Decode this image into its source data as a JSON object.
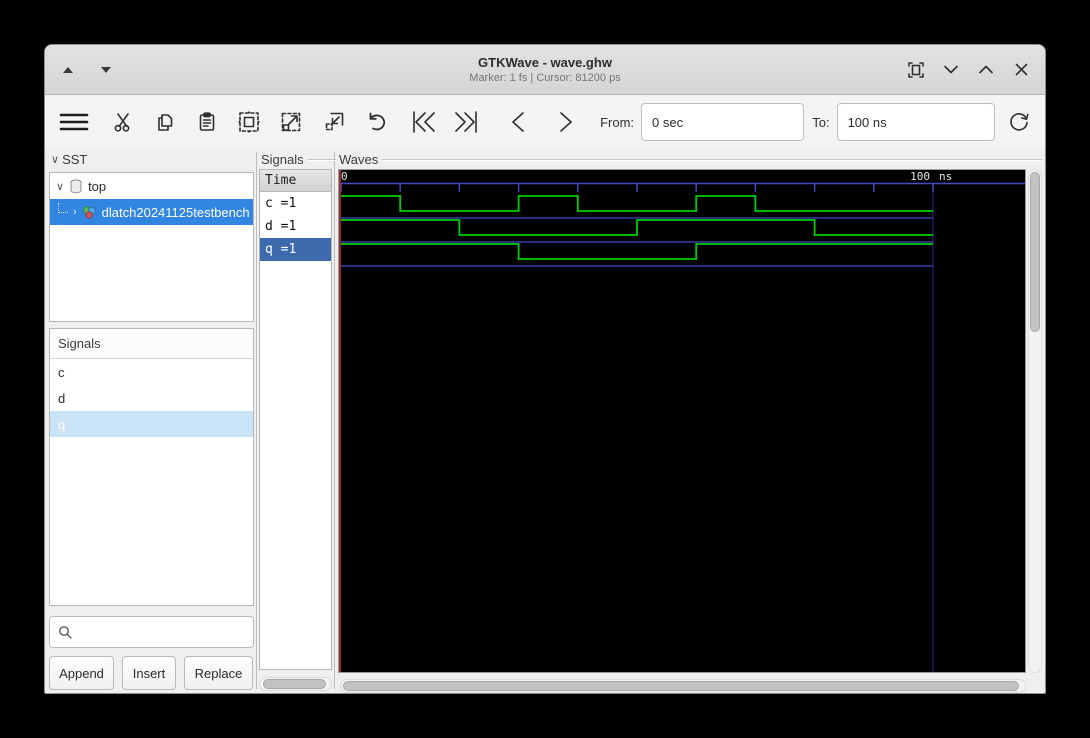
{
  "window": {
    "title": "GTKWave - wave.ghw",
    "subtitle": "Marker: 1 fs  |  Cursor: 81200 ps"
  },
  "toolbar": {
    "from_label": "From:",
    "from_value": "0 sec",
    "to_label": "To:",
    "to_value": "100 ns"
  },
  "sst": {
    "label": "SST",
    "tree": [
      {
        "label": "top"
      },
      {
        "label": "dlatch20241125testbench"
      }
    ]
  },
  "signal_search": {
    "header": "Signals",
    "items": [
      {
        "label": "c"
      },
      {
        "label": "d"
      },
      {
        "label": "q"
      }
    ],
    "search_value": "",
    "buttons": {
      "append": "Append",
      "insert": "Insert",
      "replace": "Replace"
    }
  },
  "names_panel": {
    "frame_label": "Signals",
    "time_header": "Time",
    "rows": [
      {
        "label": "c =1"
      },
      {
        "label": "d =1"
      },
      {
        "label": "q =1"
      }
    ]
  },
  "waves_panel": {
    "frame_label": "Waves"
  },
  "chart_data": {
    "type": "digital-waveform",
    "title": "GHW waveform viewer traces",
    "x_unit": "ns",
    "x_range": [
      0,
      100
    ],
    "tick_interval_ns": 10,
    "start_label": "0",
    "end_label": "100",
    "unit_label": "ns",
    "marker_time_fs": 1,
    "signals": [
      {
        "name": "c",
        "value_at_marker": 1,
        "transitions": [
          [
            0,
            1
          ],
          [
            10,
            0
          ],
          [
            30,
            1
          ],
          [
            40,
            0
          ],
          [
            60,
            1
          ],
          [
            70,
            0
          ]
        ],
        "end": 100
      },
      {
        "name": "d",
        "value_at_marker": 1,
        "transitions": [
          [
            0,
            1
          ],
          [
            20,
            0
          ],
          [
            50,
            1
          ],
          [
            80,
            0
          ]
        ],
        "end": 100
      },
      {
        "name": "q",
        "value_at_marker": 1,
        "transitions": [
          [
            0,
            1
          ],
          [
            30,
            0
          ],
          [
            60,
            1
          ]
        ],
        "end": 100
      }
    ],
    "colors": {
      "trace": "#00cf00",
      "grid_blue": "#4646cf",
      "end_gridline": "#25258f",
      "marker_red": "#c03434",
      "background": "#000000",
      "label_text": "#e6e6e6"
    }
  }
}
